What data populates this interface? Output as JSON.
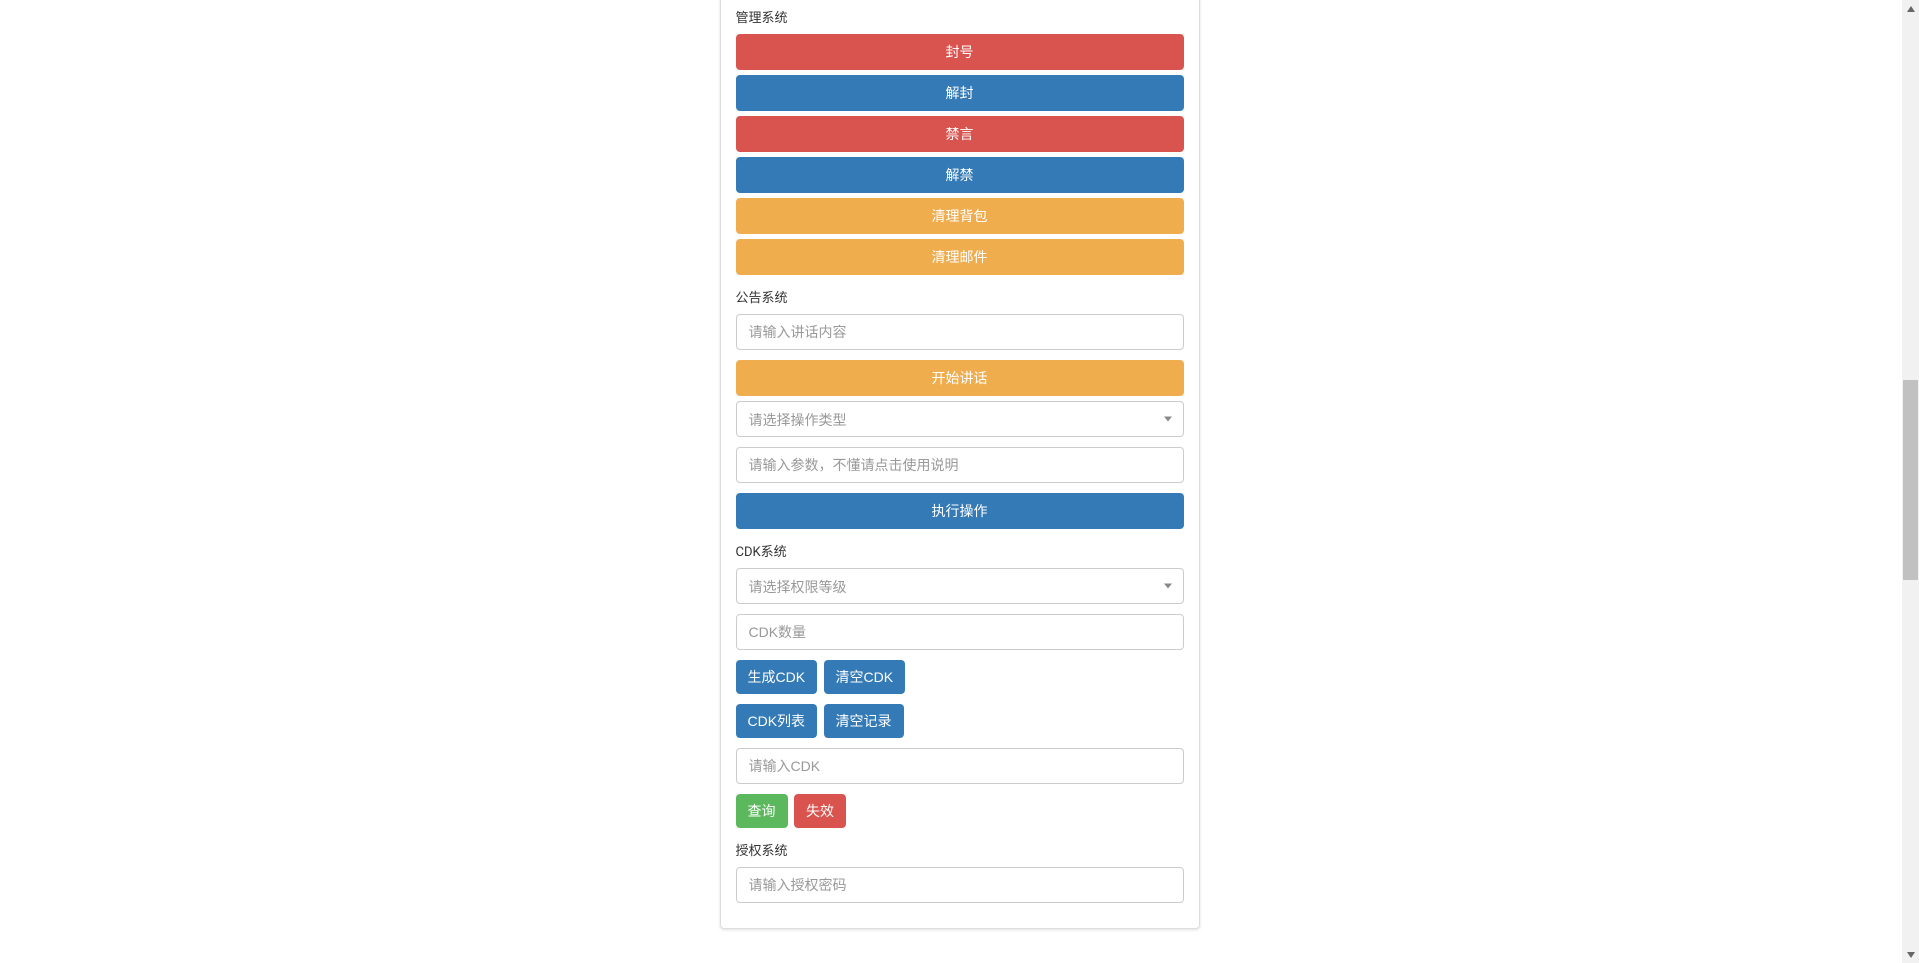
{
  "management": {
    "section_label": "管理系统",
    "buttons": {
      "ban": "封号",
      "unban": "解封",
      "mute": "禁言",
      "unmute": "解禁",
      "clear_bag": "清理背包",
      "clear_mail": "清理邮件"
    }
  },
  "announcement": {
    "section_label": "公告系统",
    "content_placeholder": "请输入讲话内容",
    "speak_button": "开始讲话",
    "select_operation_placeholder": "请选择操作类型",
    "params_placeholder": "请输入参数，不懂请点击使用说明",
    "execute_button": "执行操作"
  },
  "cdk": {
    "section_label": "CDK系统",
    "level_placeholder": "请选择权限等级",
    "quantity_placeholder": "CDK数量",
    "generate_button": "生成CDK",
    "clear_cdk_button": "清空CDK",
    "cdk_list_button": "CDK列表",
    "clear_record_button": "清空记录",
    "cdk_input_placeholder": "请输入CDK",
    "query_button": "查询",
    "invalidate_button": "失效"
  },
  "auth": {
    "section_label": "授权系统",
    "password_placeholder": "请输入授权密码"
  }
}
